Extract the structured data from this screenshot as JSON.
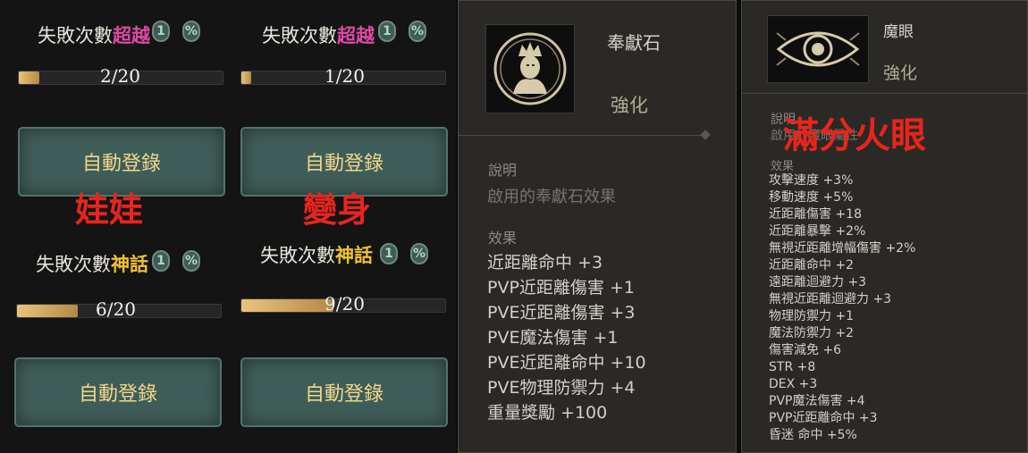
{
  "enhance": {
    "cards": [
      {
        "prefix": "失敗次數",
        "highlight": "超越",
        "hl_color": "#e04aa8",
        "badges": [
          "1",
          "%"
        ],
        "count": "2/20",
        "progress": 0.1,
        "button": "自動登錄",
        "note": "娃娃"
      },
      {
        "prefix": "失敗次數",
        "highlight": "超越",
        "hl_color": "#e04aa8",
        "badges": [
          "1",
          "%"
        ],
        "count": "1/20",
        "progress": 0.05,
        "button": "自動登錄",
        "note": "變身"
      },
      {
        "prefix": "失敗次數",
        "highlight": "神話",
        "hl_color": "#f0c232",
        "badges": [
          "1",
          "%"
        ],
        "count": "6/20",
        "progress": 0.3,
        "button": "自動登錄",
        "note": ""
      },
      {
        "prefix": "失敗次數",
        "highlight": "神話",
        "hl_color": "#f0c232",
        "badges": [
          "1",
          "%"
        ],
        "count": "9/20",
        "progress": 0.45,
        "button": "自動登錄",
        "note": ""
      }
    ]
  },
  "tooltip_stone": {
    "icon": "stone-face-icon",
    "name": "奉獻石",
    "type": "強化",
    "desc_title": "說明",
    "desc": "啟用的奉獻石效果",
    "effects_title": "效果",
    "effects": [
      "近距離命中 +3",
      "PVP近距離傷害 +1",
      "PVE近距離傷害 +3",
      "PVE魔法傷害 +1",
      "PVE近距離命中 +10",
      "PVE物理防禦力 +4",
      "重量獎勵 +100"
    ]
  },
  "tooltip_eye": {
    "icon": "eye-icon",
    "name": "魔眼",
    "type": "強化",
    "desc_title": "說明",
    "desc": "啟用的魔眼屬性",
    "note": "滿分火眼",
    "effects_title": "效果",
    "effects": [
      "攻擊速度 +3%",
      "移動速度 +5%",
      "近距離傷害 +18",
      "近距離暴擊 +2%",
      "無視近距離增幅傷害 +2%",
      "近距離命中 +2",
      "遠距離迴避力 +3",
      "無視近距離迴避力 +3",
      "物理防禦力 +1",
      "魔法防禦力 +2",
      "傷害減免 +6",
      "STR +8",
      "DEX +3",
      "PVP魔法傷害 +4",
      "PVP近距離命中 +3",
      "昏迷 命中 +5%"
    ]
  }
}
